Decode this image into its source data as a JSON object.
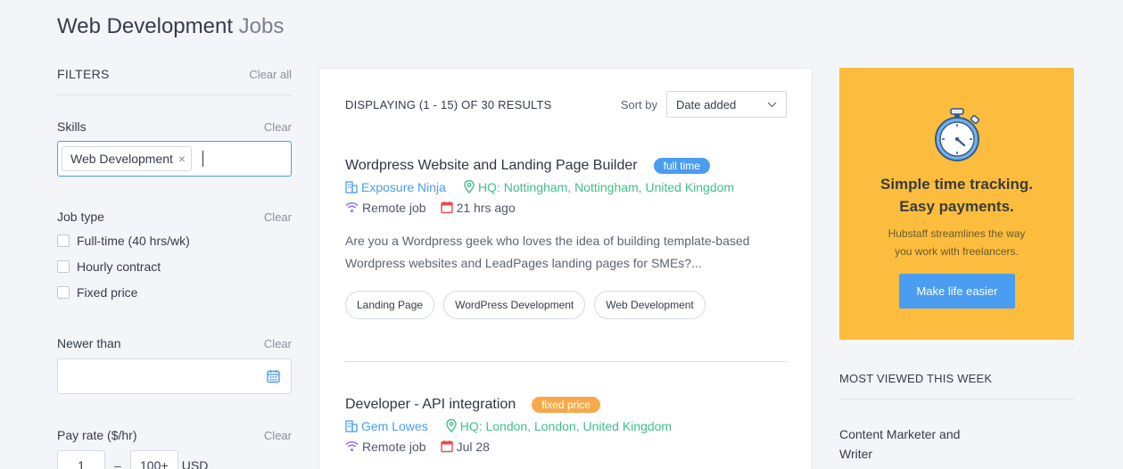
{
  "page": {
    "title_strong": "Web Development",
    "title_light": "Jobs"
  },
  "filters": {
    "label": "FILTERS",
    "clear_all": "Clear all",
    "skills": {
      "label": "Skills",
      "clear": "Clear",
      "chip": "Web Development",
      "chip_remove": "×"
    },
    "job_type": {
      "label": "Job type",
      "clear": "Clear",
      "options": [
        "Full-time (40 hrs/wk)",
        "Hourly contract",
        "Fixed price"
      ]
    },
    "newer_than": {
      "label": "Newer than",
      "clear": "Clear",
      "icon": "calendar-icon"
    },
    "pay_rate": {
      "label": "Pay rate ($/hr)",
      "clear": "Clear",
      "min": "1",
      "separator": "–",
      "max": "100+",
      "currency": "USD"
    }
  },
  "results": {
    "count_text": "DISPLAYING (1 - 15) OF 30 RESULTS",
    "sort_label": "Sort by",
    "sort_value": "Date added"
  },
  "jobs": [
    {
      "title": "Wordpress Website and Landing Page Builder",
      "badge": "full time",
      "badge_color": "#4a9df0",
      "company": "Exposure Ninja",
      "location": "HQ: Nottingham, Nottingham, United Kingdom",
      "remote": "Remote job",
      "posted": "21 hrs ago",
      "description": "Are you a Wordpress geek who loves the idea of building template-based Wordpress websites and LeadPages landing pages for SMEs?...",
      "tags": [
        "Landing Page",
        "WordPress Development",
        "Web Development"
      ]
    },
    {
      "title": "Developer - API integration",
      "badge": "fixed price",
      "badge_color": "#f5a94a",
      "company": "Gem Lowes",
      "location": "HQ: London, London, United Kingdom",
      "remote": "Remote job",
      "posted": "Jul 28"
    }
  ],
  "promo": {
    "heading_line1": "Simple time tracking.",
    "heading_line2": "Easy payments.",
    "text_line1": "Hubstaff streamlines the way",
    "text_line2": "you work with freelancers.",
    "button": "Make life easier",
    "icon": "stopwatch-icon"
  },
  "most_viewed": {
    "label": "MOST VIEWED THIS WEEK",
    "first_item": "Content Marketer and Writer"
  },
  "colors": {
    "accent": "#4a9df0",
    "green": "#3fbf8c",
    "promo_bg": "#fcbd3e",
    "calendar_red": "#e54d4d",
    "remote_purple": "#8a6df0"
  }
}
